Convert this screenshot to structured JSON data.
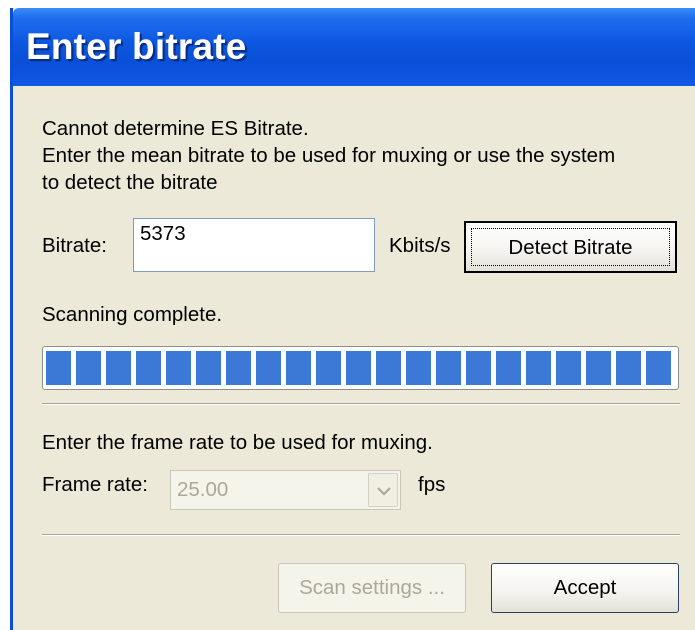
{
  "window": {
    "title": "Enter bitrate"
  },
  "message": {
    "line1": "Cannot determine ES Bitrate.",
    "line2": "Enter the mean bitrate to be used for muxing or use the system",
    "line3": "to detect the bitrate"
  },
  "bitrate": {
    "label": "Bitrate:",
    "value": "5373",
    "unit": "Kbits/s",
    "detect_button": "Detect Bitrate"
  },
  "scan": {
    "status": "Scanning complete.",
    "progress_percent": 100
  },
  "frame_rate": {
    "instruction": "Enter the frame rate to be used for muxing.",
    "label": "Frame rate:",
    "selected": "25.00",
    "unit": "fps",
    "enabled": false
  },
  "footer": {
    "scan_settings_button": "Scan settings ...",
    "accept_button": "Accept"
  },
  "colors": {
    "titlebar": "#0a4fd8",
    "progress_fill": "#3c78d6",
    "dialog_bg": "#ece9d8"
  }
}
